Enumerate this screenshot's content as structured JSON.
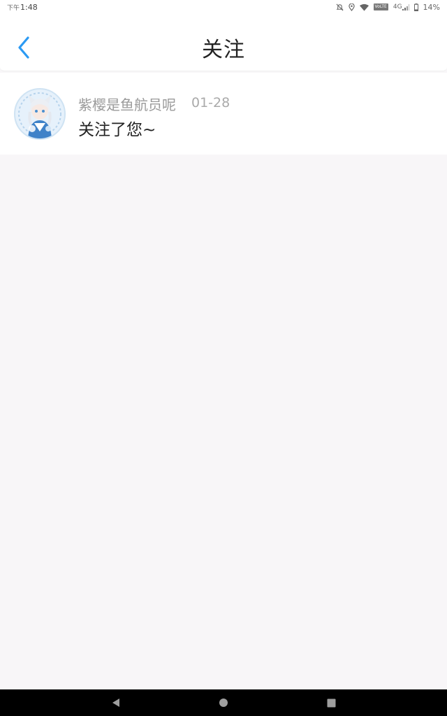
{
  "status_bar": {
    "ampm": "下午",
    "time": "1:48",
    "volte_label": "VoLTE",
    "network": "4G",
    "battery": "14%",
    "icons": [
      "mute-icon",
      "location-icon",
      "wifi-icon",
      "volte-icon",
      "signal-icon",
      "battery-icon"
    ]
  },
  "header": {
    "title": "关注",
    "back_icon": "chevron-left-icon",
    "accent_color": "#2b9af3"
  },
  "notifications": [
    {
      "user_name": "紫樱是鱼航员呢",
      "time": "01-28",
      "message": "关注了您~",
      "avatar": "user-avatar"
    }
  ],
  "nav_bar": {
    "buttons": [
      "back-triangle-icon",
      "home-circle-icon",
      "recents-square-icon"
    ]
  }
}
